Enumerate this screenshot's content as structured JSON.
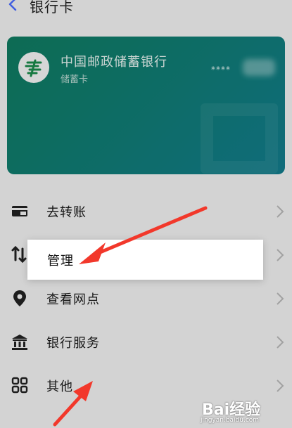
{
  "header": {
    "title": "银行卡"
  },
  "card": {
    "bank_name": "中国邮政储蓄银行",
    "card_type": "储蓄卡",
    "masked_number": "****"
  },
  "menu": {
    "items": [
      {
        "label": "去转账",
        "icon": "transfer-card-icon"
      },
      {
        "label": "",
        "icon": "exchange-icon"
      },
      {
        "label": "查看网点",
        "icon": "location-pin-icon"
      },
      {
        "label": "银行服务",
        "icon": "bank-building-icon"
      },
      {
        "label": "其他",
        "icon": "grid-icon"
      }
    ]
  },
  "popup": {
    "label": "管理"
  },
  "colors": {
    "card_start": "#0f7a5f",
    "card_end": "#137c8c",
    "arrow": "#f2382b"
  },
  "watermark": {
    "brand": "Bai经验",
    "url": "jingyan.baidu.com"
  }
}
